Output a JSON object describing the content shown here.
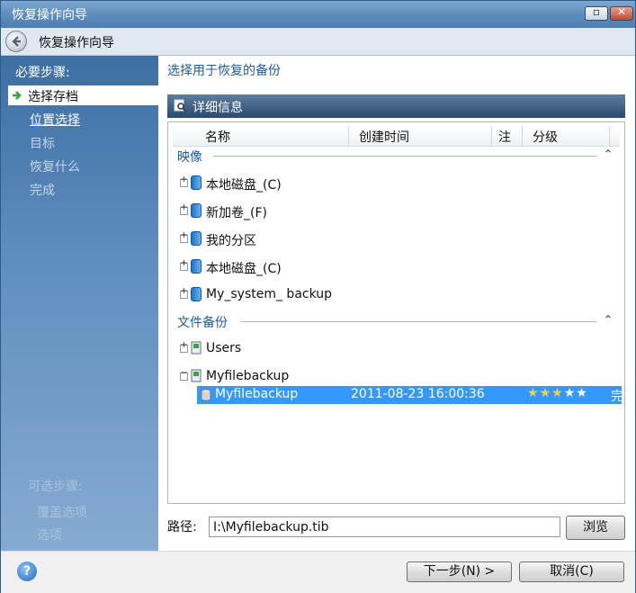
{
  "window": {
    "title": "恢复操作向导",
    "nav_title": "恢复操作向导"
  },
  "sidebar": {
    "heading": "必要步骤:",
    "steps": [
      {
        "label": "选择存档",
        "state": "active"
      },
      {
        "label": "位置选择",
        "state": "link"
      },
      {
        "label": "目标",
        "state": "disabled"
      },
      {
        "label": "恢复什么",
        "state": "disabled"
      },
      {
        "label": "完成",
        "state": "disabled"
      }
    ],
    "optional_heading": "可选步骤:",
    "optional_items": [
      "覆盖选项",
      "选项"
    ]
  },
  "main": {
    "heading": "选择用于恢复的备份",
    "detail_label": "详细信息",
    "columns": [
      "名称",
      "创建时间",
      "注",
      "分级"
    ],
    "groups": [
      {
        "label": "映像",
        "items": [
          "本地磁盘_(C)",
          "新加卷_(F)",
          "我的分区",
          "本地磁盘_(C)",
          "My_system_ backup"
        ]
      },
      {
        "label": "文件备份",
        "items": [
          "Users",
          "Myfilebackup"
        ]
      }
    ],
    "selected_row": {
      "name": "Myfilebackup",
      "created": "2011-08-23 16:00:36",
      "rating": 3,
      "rating_max": 5,
      "overflow": "完"
    },
    "path_label": "路径:",
    "path_value": "I:\\Myfilebackup.tib",
    "browse_label": "浏览"
  },
  "footer": {
    "next_label": "下一步(N) >",
    "cancel_label": "取消(C)"
  },
  "colors": {
    "accent": "#1e5aa0",
    "selection": "#3399ff",
    "sidebar_top": "#3d6fa3"
  }
}
